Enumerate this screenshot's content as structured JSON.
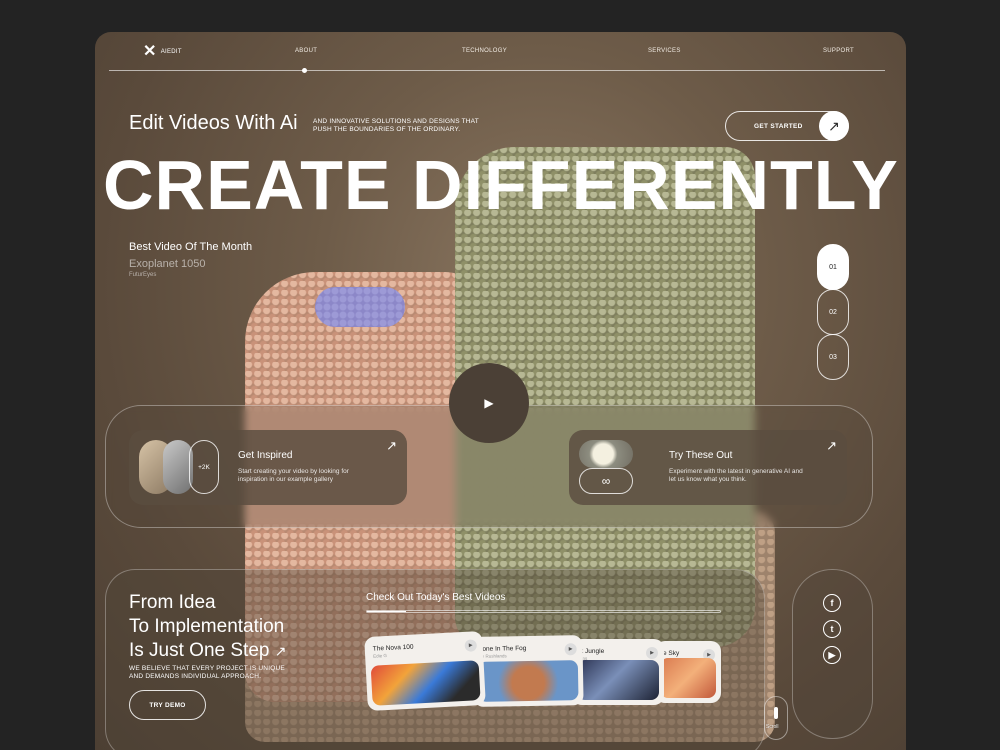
{
  "nav": {
    "logo_text": "AIEDIT",
    "links": [
      "ABOUT",
      "TECHNOLOGY",
      "SERVICES",
      "SUPPORT"
    ]
  },
  "hero": {
    "subtitle": "Edit Videos With Ai",
    "description": "AND INNOVATIVE SOLUTIONS AND DESIGNS THAT PUSH THE BOUNDARIES OF THE ORDINARY.",
    "cta_label": "GET STARTED",
    "headline": "CREATE DIFFERENTLY"
  },
  "featured": {
    "title": "Best Video Of The Month",
    "name": "Exoplanet 1050",
    "author": "FuturEyes"
  },
  "pager": [
    "01",
    "02",
    "03"
  ],
  "cards": {
    "inspired": {
      "count": "+2K",
      "title": "Get Inspired",
      "text": "Start creating your video by looking for inspiration in our example gallery"
    },
    "try": {
      "icon_text": "∞",
      "title": "Try These Out",
      "text": "Experiment with the latest in generative AI and let us know what you think."
    }
  },
  "bottom": {
    "headline_lines": [
      "From Idea",
      "To Implementation",
      "Is Just One Step"
    ],
    "description": "WE BELIEVE THAT EVERY PROJECT IS UNIQUE AND DEMANDS INDIVIDUAL APPROACH.",
    "demo_label": "TRY DEMO",
    "best_videos_title": "Check Out Today's Best Videos",
    "progress": 0.11,
    "videos": [
      {
        "title": "The Nova 100",
        "sub": "Edie G"
      },
      {
        "title": "tone In The Fog",
        "sub": "le Rushlands"
      },
      {
        "title": "k Jungle",
        "sub": "ens"
      },
      {
        "title": "e Sky",
        "sub": "s"
      }
    ],
    "scroll_label": "Scroll"
  },
  "social": [
    "facebook-icon",
    "twitter-icon",
    "youtube-icon"
  ]
}
